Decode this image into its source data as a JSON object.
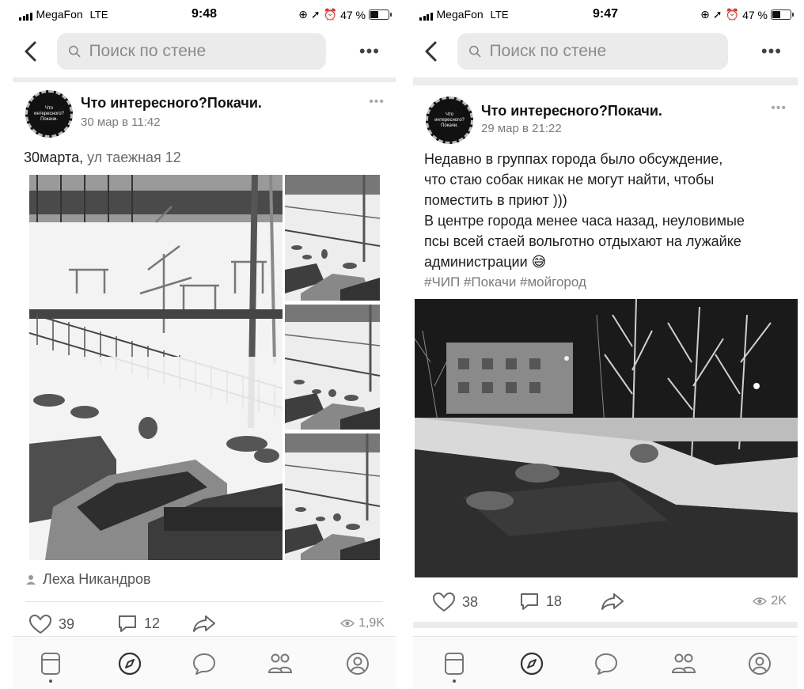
{
  "screens": [
    {
      "status": {
        "carrier": "MegaFon",
        "network": "LTE",
        "time": "9:48",
        "battery": "47 %",
        "battery_level": 0.47
      },
      "search": {
        "placeholder": "Поиск по стене"
      },
      "post": {
        "author": "Что интересного?Покачи.",
        "date": "30 мар в 11:42",
        "avatar_text": "Что интересного? Покачи.",
        "text_bold": "30марта,",
        "text_rest": " ул таежная 12",
        "signature": "Леха Никандров",
        "likes": "39",
        "comments": "12",
        "views": "1,9K"
      }
    },
    {
      "status": {
        "carrier": "MegaFon",
        "network": "LTE",
        "time": "9:47",
        "battery": "47 %",
        "battery_level": 0.47
      },
      "search": {
        "placeholder": "Поиск по стене"
      },
      "post": {
        "author": "Что интересного?Покачи.",
        "date": "29 мар в 21:22",
        "avatar_text": "Что интересного? Покачи.",
        "text_lines": [
          "Недавно в группах города было обсуждение,",
          "что стаю собак никак не могут найти, чтобы",
          "поместить в приют )))",
          "В центре города менее часа назад, неуловимые",
          "псы всей стаей  вольготно отдыхают на лужайке",
          "администрации 😅"
        ],
        "tags": "#ЧИП #Покачи #мойгород",
        "likes": "38",
        "comments": "18",
        "views": "2K"
      }
    }
  ],
  "tabbar": [
    "news-icon",
    "discover-icon",
    "messages-icon",
    "friends-icon",
    "profile-icon"
  ]
}
